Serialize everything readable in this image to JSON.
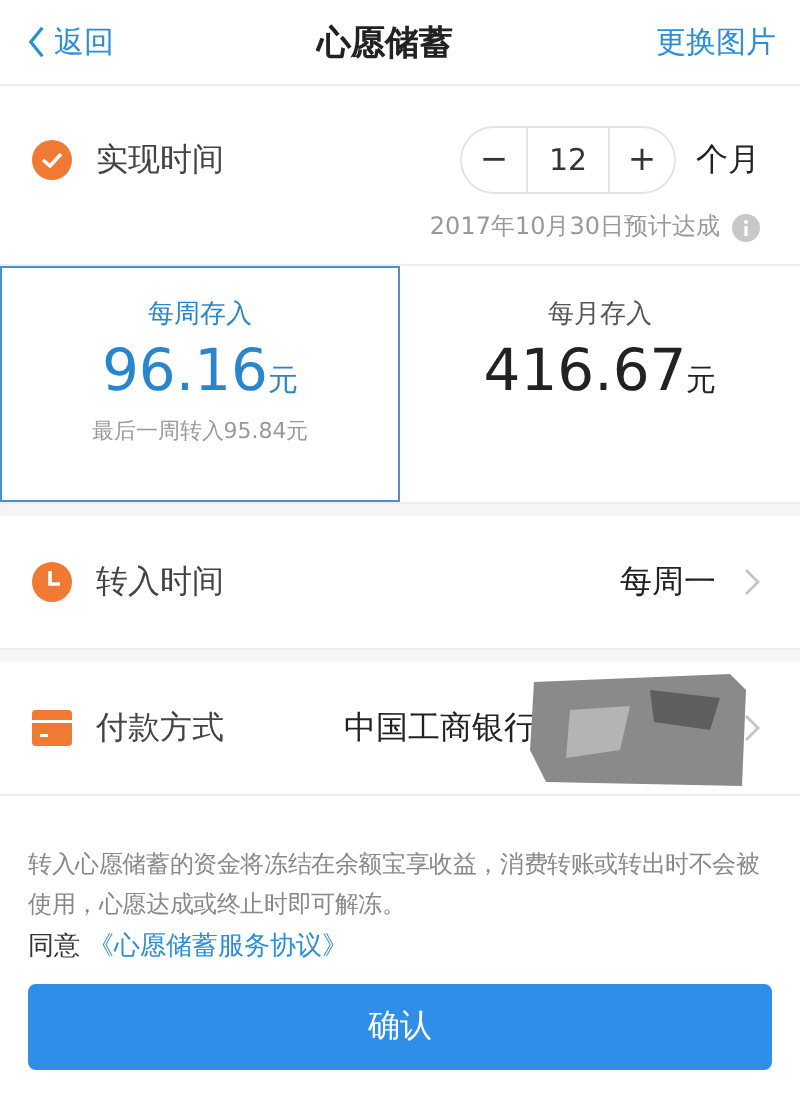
{
  "nav": {
    "back": "返回",
    "title": "心愿储蓄",
    "action": "更换图片"
  },
  "duration": {
    "label": "实现时间",
    "decrement": "−",
    "value": "12",
    "increment": "+",
    "unit": "个月",
    "estimate": "2017年10月30日预计达成"
  },
  "deposit_options": [
    {
      "label": "每周存入",
      "amount": "96.16",
      "unit": "元",
      "note": "最后一周转入95.84元",
      "selected": true
    },
    {
      "label": "每月存入",
      "amount": "416.67",
      "unit": "元",
      "selected": false
    }
  ],
  "settings": [
    {
      "kind": "clock",
      "label": "转入时间",
      "value": "每周一",
      "redacted": false
    },
    {
      "kind": "card",
      "label": "付款方式",
      "value": "中国工商银行",
      "redacted": true
    }
  ],
  "notice": "转入心愿储蓄的资金将冻结在余额宝享收益，消费转账或转出时不会被使用，心愿达成或终止时即可解冻。",
  "agreement": {
    "prefix": "同意",
    "link": "《心愿储蓄服务协议》"
  },
  "confirm": "确认"
}
